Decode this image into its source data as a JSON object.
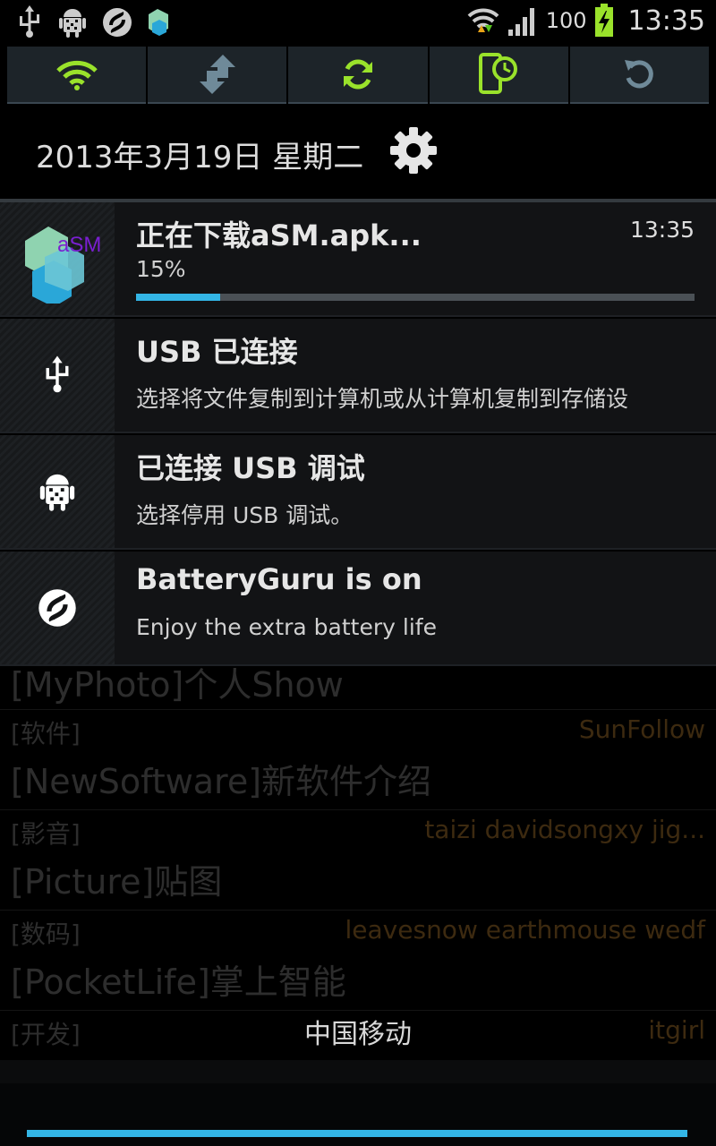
{
  "status_bar": {
    "battery_percent": "100",
    "time": "13:35"
  },
  "quick_settings": {
    "toggles": [
      {
        "name": "wifi-icon",
        "active": true
      },
      {
        "name": "mobile-data-icon",
        "active": false
      },
      {
        "name": "sync-icon",
        "active": true
      },
      {
        "name": "screen-timeout-icon",
        "active": true
      },
      {
        "name": "auto-rotate-icon",
        "active": false
      }
    ],
    "active_color": "#9ae22b",
    "inactive_color": "#6f8a99"
  },
  "header": {
    "date": "2013年3月19日 星期二"
  },
  "notifications": [
    {
      "app_label": "aSM",
      "title": "正在下载aSM.apk...",
      "time": "13:35",
      "progress_text": "15%",
      "progress": 0.15
    },
    {
      "title": "USB 已连接",
      "subtitle": "选择将文件复制到计算机或从计算机复制到存储设"
    },
    {
      "title": "已连接 USB 调试",
      "subtitle": "选择停用 USB 调试。"
    },
    {
      "title": "BatteryGuru is on",
      "subtitle": "Enjoy the extra battery life"
    }
  ],
  "background_list": [
    {
      "forum": "[MyPhoto]个人Show"
    },
    {
      "category": "[软件]",
      "users": "SunFollow",
      "forum": "[NewSoftware]新软件介绍"
    },
    {
      "category": "[影音]",
      "users": "taizi davidsongxy jig...",
      "forum": "[Picture]贴图"
    },
    {
      "category": "[数码]",
      "users": "leavesnow earthmouse wedf",
      "forum": "[PocketLife]掌上智能"
    },
    {
      "category": "[开发]",
      "users": "itgirl"
    }
  ],
  "carrier": "中国移动",
  "accent_color": "#33b5e5"
}
